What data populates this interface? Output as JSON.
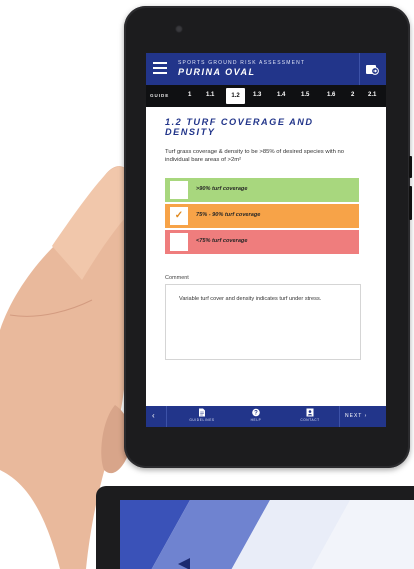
{
  "app": {
    "subtitle": "SPORTS GROUND RISK ASSESSMENT",
    "title": "PURINA OVAL"
  },
  "section_nav": {
    "guide_label": "GUIDE",
    "items": [
      "1",
      "1.1",
      "1.2",
      "1.3",
      "1.4",
      "1.5",
      "1.6",
      "2",
      "2.1"
    ],
    "active": "1.2"
  },
  "section": {
    "heading_line1": "1.2 TURF COVERAGE AND",
    "heading_line2": "DENSITY",
    "description": "Turf grass coverage & density to be >85% of desired species with no individual bare areas of >2m²"
  },
  "options": [
    {
      "label": ">90% turf coverage",
      "checked": false,
      "color": "#a8d77e"
    },
    {
      "label": "75% - 90% turf coverage",
      "checked": true,
      "color": "#f7a348"
    },
    {
      "label": "<75% turf coverage",
      "checked": false,
      "color": "#ef7d7d"
    }
  ],
  "comment": {
    "label": "Comment",
    "value": "Variable turf cover and density indicates turf under stress."
  },
  "toolbar": {
    "back_glyph": "‹",
    "guidelines_label": "GUIDELINES",
    "help_label": "HELP",
    "contact_label": "CONTACT",
    "next_label": "NEXT ›"
  },
  "colors": {
    "brand_blue": "#22358a",
    "nav_black": "#0f1012"
  },
  "icons": [
    "menu-icon",
    "export-icon",
    "guidelines-icon",
    "help-icon",
    "contact-icon",
    "checkmark-icon"
  ]
}
